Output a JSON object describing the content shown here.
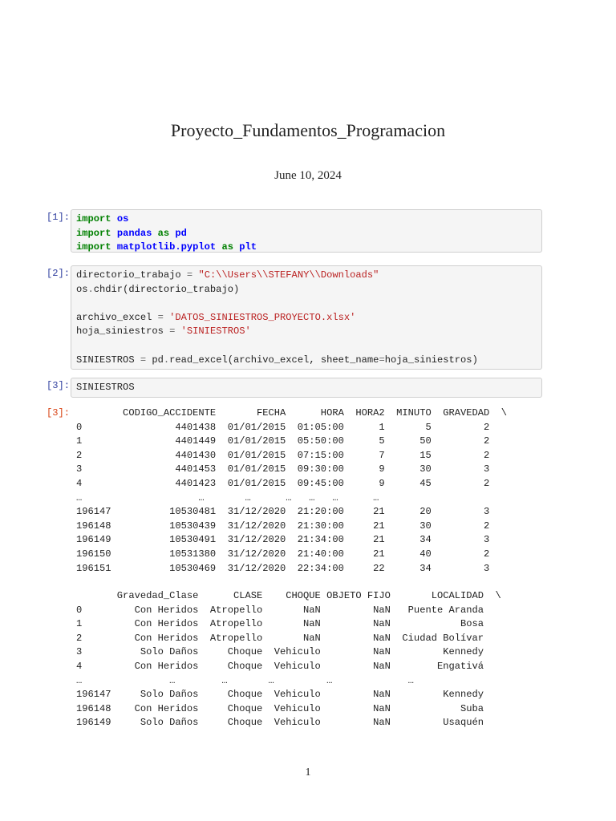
{
  "title": "Proyecto_Fundamentos_Programacion",
  "date": "June 10, 2024",
  "cells": [
    {
      "prompt": "[1]:",
      "lines": [
        [
          [
            "kw",
            "import"
          ],
          [
            "",
            ""
          ],
          [
            "",
            " "
          ],
          [
            "nm",
            "os"
          ]
        ],
        [
          [
            "kw",
            "import"
          ],
          [
            "",
            " "
          ],
          [
            "nm",
            "pandas"
          ],
          [
            "",
            " "
          ],
          [
            "kw",
            "as"
          ],
          [
            "",
            " "
          ],
          [
            "nm",
            "pd"
          ]
        ],
        [
          [
            "kw",
            "import"
          ],
          [
            "",
            " "
          ],
          [
            "nm",
            "matplotlib.pyplot"
          ],
          [
            "",
            " "
          ],
          [
            "kw",
            "as"
          ],
          [
            "",
            " "
          ],
          [
            "nm",
            "plt"
          ]
        ]
      ]
    },
    {
      "prompt": "[2]:",
      "lines": [
        [
          [
            "",
            "directorio_trabajo "
          ],
          [
            "op",
            "="
          ],
          [
            "",
            " "
          ],
          [
            "st",
            "\"C:\\\\Users\\\\STEFANY\\\\Downloads\""
          ]
        ],
        [
          [
            "",
            "os"
          ],
          [
            "op",
            "."
          ],
          [
            "",
            "chdir(directorio_trabajo)"
          ]
        ],
        [
          [
            "",
            ""
          ]
        ],
        [
          [
            "",
            "archivo_excel "
          ],
          [
            "op",
            "="
          ],
          [
            "",
            " "
          ],
          [
            "st",
            "'DATOS_SINIESTROS_PROYECTO.xlsx'"
          ]
        ],
        [
          [
            "",
            "hoja_siniestros "
          ],
          [
            "op",
            "="
          ],
          [
            "",
            " "
          ],
          [
            "st",
            "'SINIESTROS'"
          ]
        ],
        [
          [
            "",
            ""
          ]
        ],
        [
          [
            "",
            "SINIESTROS "
          ],
          [
            "op",
            "="
          ],
          [
            "",
            " pd"
          ],
          [
            "op",
            "."
          ],
          [
            "",
            "read_excel(archivo_excel, sheet_name"
          ],
          [
            "op",
            "="
          ],
          [
            "",
            "hoja_siniestros)"
          ]
        ]
      ]
    },
    {
      "prompt": "[3]:",
      "lines": [
        [
          [
            "",
            "SINIESTROS"
          ]
        ]
      ]
    }
  ],
  "output": {
    "prompt": "[3]:",
    "table1": [
      "        CODIGO_ACCIDENTE       FECHA      HORA  HORA2  MINUTO  GRAVEDAD  \\",
      "0                4401438  01/01/2015  01:05:00      1       5         2",
      "1                4401449  01/01/2015  05:50:00      5      50         2",
      "2                4401430  01/01/2015  07:15:00      7      15         2",
      "3                4401453  01/01/2015  09:30:00      9      30         3",
      "4                4401423  01/01/2015  09:45:00      9      45         2",
      "…                    …       …      …   …   …      …",
      "196147          10530481  31/12/2020  21:20:00     21      20         3",
      "196148          10530439  31/12/2020  21:30:00     21      30         2",
      "196149          10530491  31/12/2020  21:34:00     21      34         3",
      "196150          10531380  31/12/2020  21:40:00     21      40         2",
      "196151          10530469  31/12/2020  22:34:00     22      34         3"
    ],
    "table2": [
      "       Gravedad_Clase      CLASE    CHOQUE OBJETO FIJO       LOCALIDAD  \\",
      "0         Con Heridos  Atropello       NaN         NaN   Puente Aranda",
      "1         Con Heridos  Atropello       NaN         NaN            Bosa",
      "2         Con Heridos  Atropello       NaN         NaN  Ciudad Bolívar",
      "3          Solo Daños     Choque  Vehiculo         NaN         Kennedy",
      "4         Con Heridos     Choque  Vehiculo         NaN        Engativá",
      "…               …        …       …         …             …",
      "196147     Solo Daños     Choque  Vehiculo         NaN         Kennedy",
      "196148    Con Heridos     Choque  Vehiculo         NaN            Suba",
      "196149     Solo Daños     Choque  Vehiculo         NaN         Usaquén"
    ]
  },
  "page_number": "1"
}
